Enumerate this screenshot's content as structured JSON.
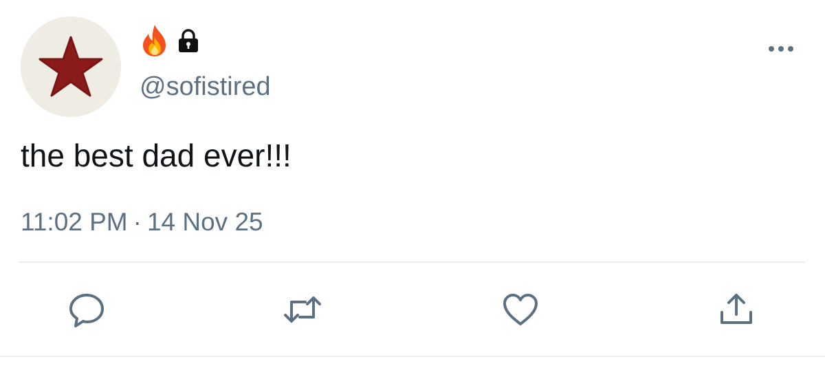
{
  "user": {
    "name_emoji_1": "fire-icon",
    "name_emoji_2": "lock-icon",
    "handle": "@sofistired",
    "avatar_icon": "star-icon"
  },
  "tweet": {
    "text": "the best dad ever!!!",
    "time": "11:02 PM",
    "separator": "·",
    "date": "14 Nov 25"
  },
  "actions": [
    {
      "name": "reply",
      "icon": "reply-icon"
    },
    {
      "name": "retweet",
      "icon": "retweet-icon"
    },
    {
      "name": "like",
      "icon": "heart-icon"
    },
    {
      "name": "share",
      "icon": "share-icon"
    }
  ],
  "more_icon": "more-dots-icon",
  "colors": {
    "text": "#0f1419",
    "secondary": "#5b7083",
    "avatar_bg": "#efece4",
    "star": "#8b1a1a",
    "divider": "#e6ecf0"
  }
}
